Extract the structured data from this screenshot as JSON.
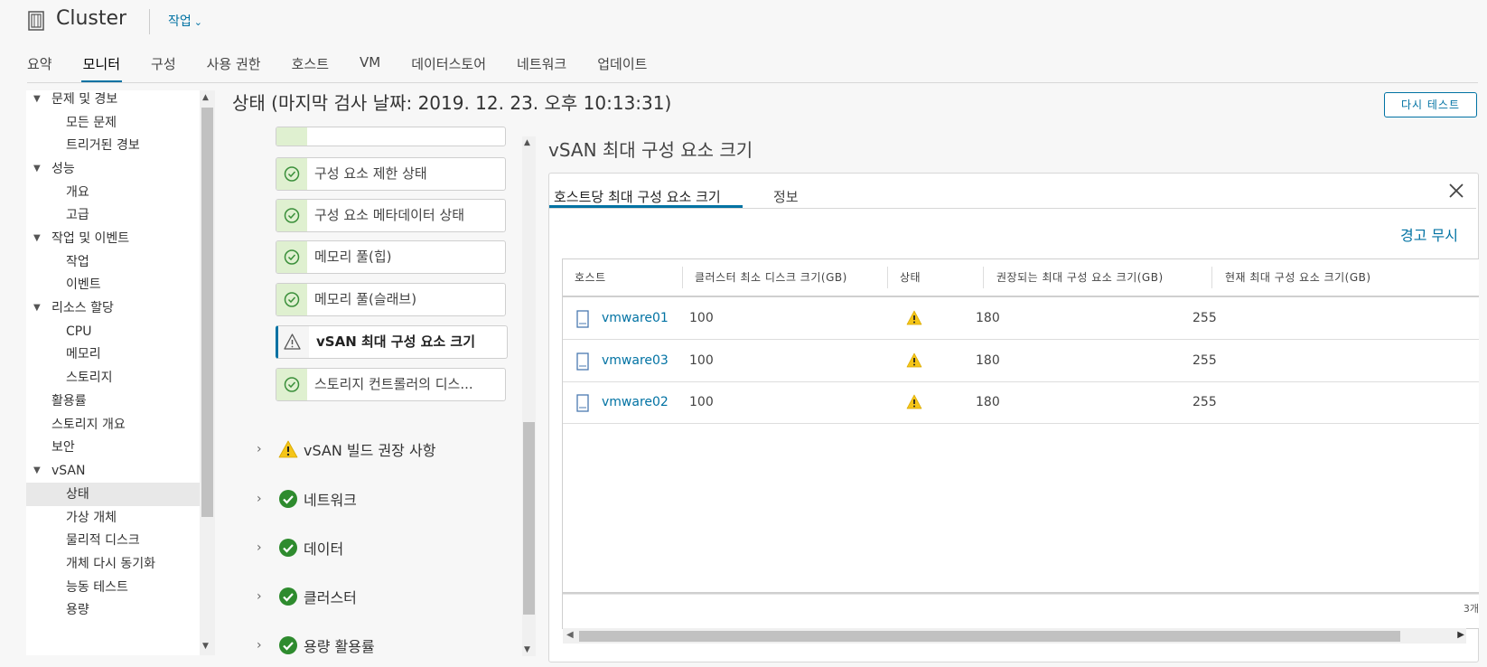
{
  "header": {
    "title": "Cluster",
    "actions_label": "작업"
  },
  "tabs": [
    {
      "label": "요약"
    },
    {
      "label": "모니터"
    },
    {
      "label": "구성"
    },
    {
      "label": "사용 권한"
    },
    {
      "label": "호스트"
    },
    {
      "label": "VM"
    },
    {
      "label": "데이터스토어"
    },
    {
      "label": "네트워크"
    },
    {
      "label": "업데이트"
    }
  ],
  "active_tab": "모니터",
  "leftnav": {
    "items": [
      {
        "label": "문제 및 경보",
        "level": 0,
        "expanded": true
      },
      {
        "label": "모든 문제",
        "level": 1
      },
      {
        "label": "트리거된 경보",
        "level": 1
      },
      {
        "label": "성능",
        "level": 0,
        "expanded": true
      },
      {
        "label": "개요",
        "level": 1
      },
      {
        "label": "고급",
        "level": 1
      },
      {
        "label": "작업 및 이벤트",
        "level": 0,
        "expanded": true
      },
      {
        "label": "작업",
        "level": 1
      },
      {
        "label": "이벤트",
        "level": 1
      },
      {
        "label": "리소스 할당",
        "level": 0,
        "expanded": true
      },
      {
        "label": "CPU",
        "level": 1
      },
      {
        "label": "메모리",
        "level": 1
      },
      {
        "label": "스토리지",
        "level": 1
      },
      {
        "label": "활용률",
        "level": 0
      },
      {
        "label": "스토리지 개요",
        "level": 0
      },
      {
        "label": "보안",
        "level": 0
      },
      {
        "label": "vSAN",
        "level": 0,
        "expanded": true
      },
      {
        "label": "상태",
        "level": 1,
        "selected": true
      },
      {
        "label": "가상 개체",
        "level": 1
      },
      {
        "label": "물리적 디스크",
        "level": 1
      },
      {
        "label": "개체 다시 동기화",
        "level": 1
      },
      {
        "label": "능동 테스트",
        "level": 1
      },
      {
        "label": "용량",
        "level": 1
      }
    ]
  },
  "main": {
    "heading": "상태 (마지막 검사 날짜: 2019. 12. 23. 오후 10:13:31)",
    "retest_label": "다시 테스트",
    "checks": [
      {
        "label": "구성 요소 제한 상태",
        "status": "ok"
      },
      {
        "label": "구성 요소 메타데이터 상태",
        "status": "ok"
      },
      {
        "label": "메모리 풀(힙)",
        "status": "ok"
      },
      {
        "label": "메모리 풀(슬래브)",
        "status": "ok"
      },
      {
        "label": "vSAN 최대 구성 요소 크기",
        "status": "warning",
        "selected": true
      },
      {
        "label": "스토리지 컨트롤러의 디스...",
        "status": "ok"
      }
    ],
    "groups": [
      {
        "label": "vSAN 빌드 권장 사항",
        "status": "warning"
      },
      {
        "label": "네트워크",
        "status": "ok"
      },
      {
        "label": "데이터",
        "status": "ok"
      },
      {
        "label": "클러스터",
        "status": "ok"
      },
      {
        "label": "용량 활용률",
        "status": "ok"
      }
    ]
  },
  "detail": {
    "title": "vSAN 최대 구성 요소 크기",
    "tabs": [
      {
        "label": "호스트당 최대 구성 요소 크기"
      },
      {
        "label": "정보"
      }
    ],
    "ignore_label": "경고 무시",
    "columns": [
      "호스트",
      "클러스터 최소 디스크 크기(GB)",
      "상태",
      "권장되는 최대 구성 요소 크기(GB)",
      "현재 최대 구성 요소 크기(GB)"
    ],
    "rows": [
      {
        "host": "vmware01",
        "min_disk": "100",
        "status": "warning",
        "recommended": "180",
        "current": "255"
      },
      {
        "host": "vmware03",
        "min_disk": "100",
        "status": "warning",
        "recommended": "180",
        "current": "255"
      },
      {
        "host": "vmware02",
        "min_disk": "100",
        "status": "warning",
        "recommended": "180",
        "current": "255"
      }
    ],
    "footer_count": "3개"
  },
  "colors": {
    "accent": "#0072a3",
    "ok": "#2e8b2e",
    "warning": "#f5c518"
  }
}
